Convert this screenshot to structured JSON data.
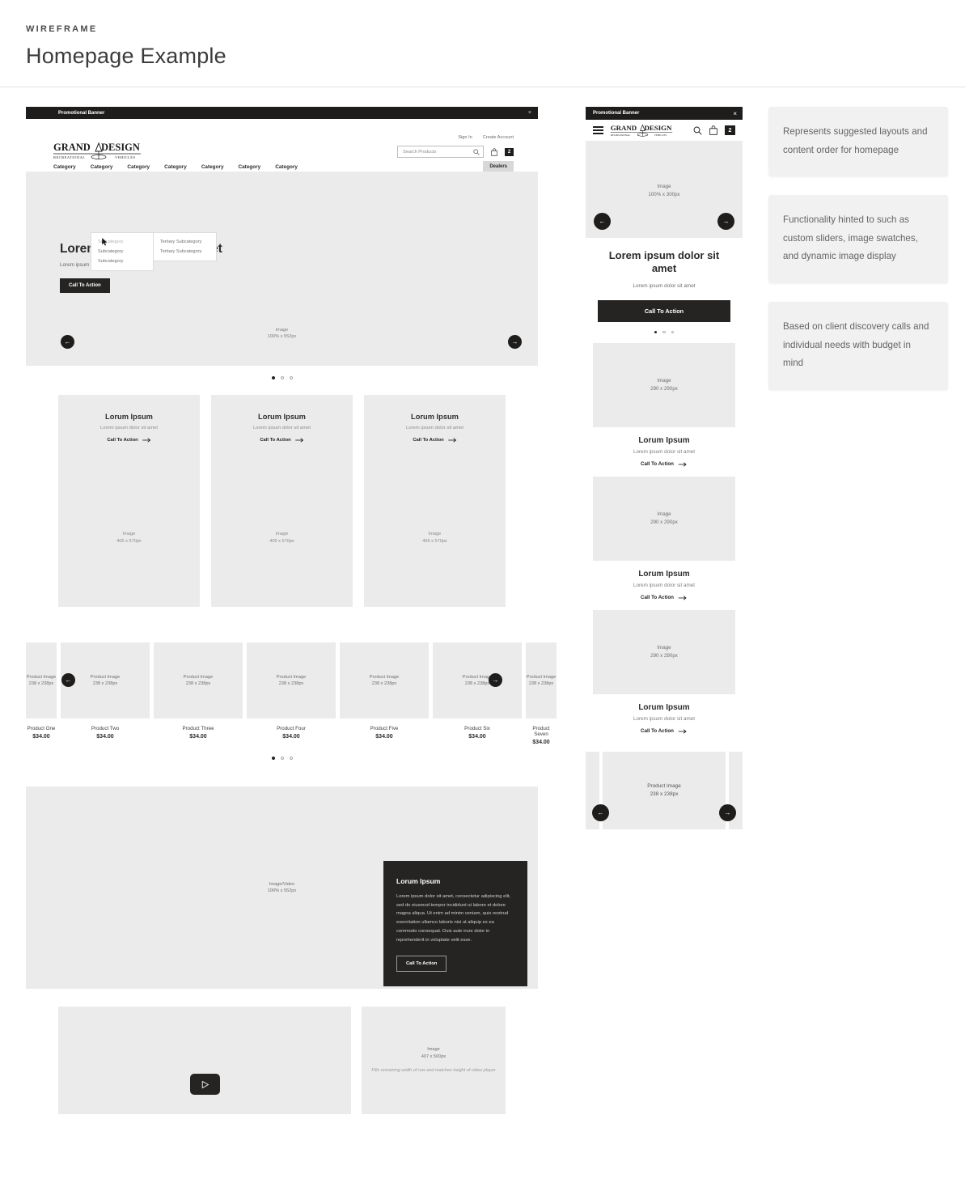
{
  "page": {
    "eyebrow": "WIREFRAME",
    "title": "Homepage Example"
  },
  "colors": {
    "dark": "#1f1d1c",
    "panel": "#262422",
    "placeholder": "#ebebeb",
    "note_bg": "#f1f1f1"
  },
  "desktop": {
    "promo_banner": {
      "label": "Promotional Banner",
      "close": "×"
    },
    "account": {
      "sign_in": "Sign In",
      "create_account": "Create Account"
    },
    "logo": {
      "name": "GRAND DESIGN",
      "tagline_left": "RECREATIONAL",
      "tagline_right": "VEHICLES"
    },
    "search": {
      "placeholder": "Search Products",
      "icon": "search-icon"
    },
    "cart": {
      "icon": "shopping-bag-icon",
      "count": "2"
    },
    "dealers_button": "Dealers",
    "nav": [
      "Category",
      "Category",
      "Category",
      "Category",
      "Category",
      "Category",
      "Category"
    ],
    "dropdown": {
      "subcategories": [
        "Subcategory",
        "Subcategory",
        "Subcategory"
      ],
      "tertiary": [
        "Tertiary Subcategory",
        "Tertiary Subcategory"
      ]
    },
    "hero": {
      "heading": "Lorem ipsum dolor sit amet",
      "subheading": "Lorem ipsum dolor sit amet",
      "cta": "Call To Action",
      "image_label": "Image",
      "image_dims": "100% x 552px",
      "prev": "←",
      "next": "→"
    },
    "feature_cards": [
      {
        "title": "Lorum Ipsum",
        "sub": "Lorem ipsum dolor sit amet",
        "cta": "Call To Action",
        "image_label": "Image",
        "image_dims": "405 x 570px"
      },
      {
        "title": "Lorum Ipsum",
        "sub": "Lorem ipsum dolor sit amet",
        "cta": "Call To Action",
        "image_label": "Image",
        "image_dims": "405 x 570px"
      },
      {
        "title": "Lorum Ipsum",
        "sub": "Lorem ipsum dolor sit amet",
        "cta": "Call To Action",
        "image_label": "Image",
        "image_dims": "405 x 570px"
      }
    ],
    "products": {
      "image_label": "Product Image",
      "image_dims": "238 x 238px",
      "items": [
        {
          "name": "Product One",
          "price": "$34.00"
        },
        {
          "name": "Product Two",
          "price": "$34.00"
        },
        {
          "name": "Product Three",
          "price": "$34.00"
        },
        {
          "name": "Product Four",
          "price": "$34.00"
        },
        {
          "name": "Product Five",
          "price": "$34.00"
        },
        {
          "name": "Product Six",
          "price": "$34.00"
        },
        {
          "name": "Product Seven",
          "price": "$34.00"
        }
      ],
      "prev": "←",
      "next": "→"
    },
    "split": {
      "image_label": "Image/Video",
      "image_dims": "100% x 552px",
      "panel_title": "Lorum Ipsum",
      "panel_body": "Lorem ipsum dolor sit amet, consectetur adipiscing elit, sed do eiusmod tempor incididunt ut labore et dolore magna aliqua. Ut enim ad minim veniam, quis nostrud exercitation ullamco laboris nisi ut aliquip ex ea commodo consequat. Duis aute irure dolor in reprehenderit in voluptate velit esse.",
      "panel_cta": "Call To Action"
    },
    "video_row": {
      "play_icon": "play-icon",
      "side_image_label": "Image",
      "side_image_dims": "407 x 500px",
      "side_note": "Fills remaining width of row and matches height of video player"
    }
  },
  "mobile": {
    "promo_banner": {
      "label": "Promotional Banner",
      "close": "×"
    },
    "menu_icon": "hamburger-menu-icon",
    "logo": {
      "name": "GRAND DESIGN"
    },
    "search_icon": "search-icon",
    "cart_icon": "shopping-bag-icon",
    "cart_count": "2",
    "hero": {
      "image_label": "Image",
      "image_dims": "100% x 300px",
      "heading": "Lorem ipsum dolor sit amet",
      "subheading": "Lorem ipsum dolor sit amet",
      "cta": "Call To Action",
      "prev": "←",
      "next": "→"
    },
    "cards": [
      {
        "image_label": "Image",
        "image_dims": "290 x 290px",
        "title": "Lorum Ipsum",
        "sub": "Lorem ipsum dolor sit amet",
        "cta": "Call To Action"
      },
      {
        "image_label": "Image",
        "image_dims": "290 x 290px",
        "title": "Lorum Ipsum",
        "sub": "Lorem ipsum dolor sit amet",
        "cta": "Call To Action"
      },
      {
        "image_label": "Image",
        "image_dims": "290 x 290px",
        "title": "Lorum Ipsum",
        "sub": "Lorem ipsum dolor sit amet",
        "cta": "Call To Action"
      }
    ],
    "products": {
      "image_label": "Product Image",
      "image_dims": "238 x 238px",
      "prev": "←",
      "next": "→"
    }
  },
  "notes": [
    "Represents suggested layouts and content order for homepage",
    "Functionality hinted to such as custom sliders, image swatches, and dynamic image display",
    "Based on client discovery calls and individual needs with budget in mind"
  ]
}
